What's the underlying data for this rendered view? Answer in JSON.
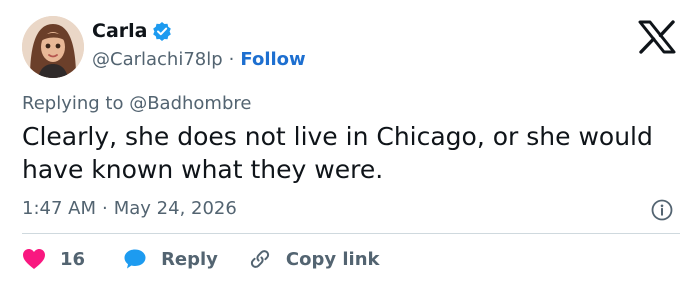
{
  "author": {
    "name": "Carla",
    "handle": "@Carlachi78lp",
    "follow_label": "Follow",
    "separator": "·"
  },
  "reply_context": "Replying to @Badhombre",
  "tweet": {
    "text": "Clearly, she does not live in Chicago, or she would have known what they were.",
    "time": "1:47 AM",
    "date": "May 24, 2026",
    "separator": "·"
  },
  "actions": {
    "like_count": "16",
    "reply_label": "Reply",
    "copy_label": "Copy link"
  },
  "colors": {
    "like": "#f91880",
    "reply": "#1d9bf0",
    "link": "#1d6fd0",
    "muted": "#536471"
  },
  "icons": {
    "verified": "verified-badge-icon",
    "logo": "x-logo-icon",
    "info": "info-icon",
    "like": "heart-icon",
    "reply": "speech-bubble-icon",
    "copy": "link-icon"
  }
}
